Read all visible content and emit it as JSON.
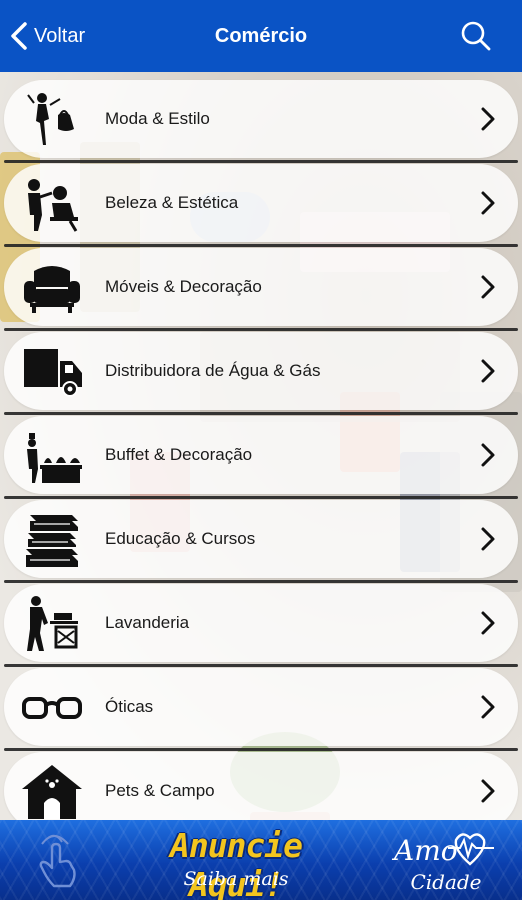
{
  "header": {
    "back_label": "Voltar",
    "title": "Comércio",
    "bar_color": "#0a53c5"
  },
  "categories": [
    {
      "label": "Moda & Estilo",
      "icon": "fashion-icon"
    },
    {
      "label": "Beleza & Estética",
      "icon": "beauty-salon-icon"
    },
    {
      "label": "Móveis & Decoração",
      "icon": "armchair-icon"
    },
    {
      "label": "Distribuidora de Água & Gás",
      "icon": "delivery-truck-icon"
    },
    {
      "label": "Buffet & Decoração",
      "icon": "buffet-icon"
    },
    {
      "label": "Educação & Cursos",
      "icon": "books-icon"
    },
    {
      "label": "Lavanderia",
      "icon": "laundry-icon"
    },
    {
      "label": "Óticas",
      "icon": "glasses-icon"
    },
    {
      "label": "Pets & Campo",
      "icon": "doghouse-icon"
    }
  ],
  "banner": {
    "title": "Anuncie Aqui!",
    "subtitle": "Saiba mais",
    "logo_text": "Cidade",
    "logo_script": "Amo"
  }
}
